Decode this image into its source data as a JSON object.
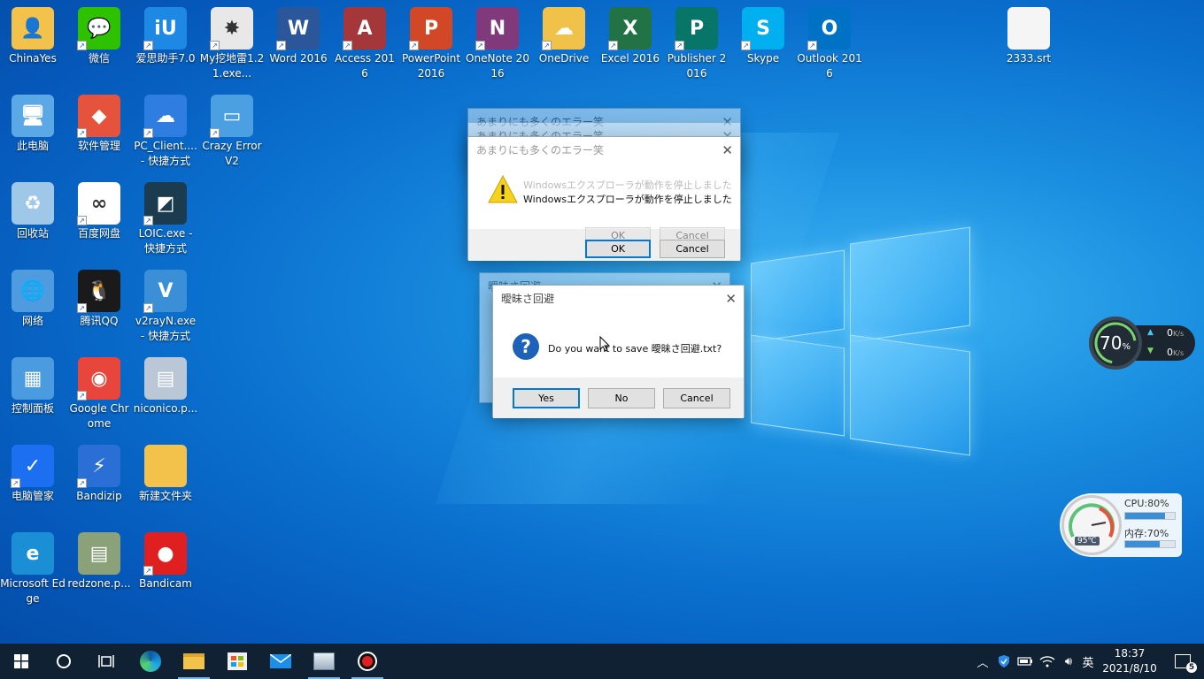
{
  "desktop_icons": [
    {
      "label": "ChinaYes",
      "glyph": "👤",
      "bg": "#f3c24a"
    },
    {
      "label": "微信",
      "glyph": "💬",
      "bg": "#2dc100"
    },
    {
      "label": "爱思助手7.0",
      "glyph": "iU",
      "bg": "#1e88e5"
    },
    {
      "label": "My挖地雷1.21.exe...",
      "glyph": "✸",
      "bg": "#e8e8e8"
    },
    {
      "label": "Word 2016",
      "glyph": "W",
      "bg": "#2b579a"
    },
    {
      "label": "Access 2016",
      "glyph": "A",
      "bg": "#a4373a"
    },
    {
      "label": "PowerPoint 2016",
      "glyph": "P",
      "bg": "#d24726"
    },
    {
      "label": "OneNote 2016",
      "glyph": "N",
      "bg": "#80397b"
    },
    {
      "label": "OneDrive",
      "glyph": "☁",
      "bg": "#f0c24a"
    },
    {
      "label": "Excel 2016",
      "glyph": "X",
      "bg": "#217346"
    },
    {
      "label": "Publisher 2016",
      "glyph": "P",
      "bg": "#077568"
    },
    {
      "label": "Skype",
      "glyph": "S",
      "bg": "#00aff0"
    },
    {
      "label": "Outlook 2016",
      "glyph": "O",
      "bg": "#0072c6"
    },
    {
      "label": "2333.srt",
      "glyph": "",
      "bg": "#f5f5f5"
    },
    {
      "label": "此电脑",
      "glyph": "🖥",
      "bg": "#5aa8e6"
    },
    {
      "label": "软件管理",
      "glyph": "◆",
      "bg": "#e6533c"
    },
    {
      "label": "PC_Client.... - 快捷方式",
      "glyph": "☁",
      "bg": "#2f7de0"
    },
    {
      "label": "Crazy Error V2",
      "glyph": "▭",
      "bg": "#4aa0e0"
    },
    {
      "label": "回收站",
      "glyph": "♻",
      "bg": "#9fc8e8"
    },
    {
      "label": "百度网盘",
      "glyph": "∞",
      "bg": "#ffffff"
    },
    {
      "label": "LOIC.exe - 快捷方式",
      "glyph": "◩",
      "bg": "#1b3c4f"
    },
    {
      "label": "网络",
      "glyph": "🌐",
      "bg": "#4f9be0"
    },
    {
      "label": "腾讯QQ",
      "glyph": "🐧",
      "bg": "#1a1a1a"
    },
    {
      "label": "v2rayN.exe - 快捷方式",
      "glyph": "V",
      "bg": "#3a8fd6"
    },
    {
      "label": "控制面板",
      "glyph": "▦",
      "bg": "#4b9be0"
    },
    {
      "label": "Google Chrome",
      "glyph": "◉",
      "bg": "#e8453c"
    },
    {
      "label": "niconico.p...",
      "glyph": "▤",
      "bg": "#b9c7d6"
    },
    {
      "label": "电脑管家",
      "glyph": "✓",
      "bg": "#1d6ff2"
    },
    {
      "label": "Bandizip",
      "glyph": "⚡",
      "bg": "#2a6fd6"
    },
    {
      "label": "新建文件夹",
      "glyph": "",
      "bg": "#f3c24a"
    },
    {
      "label": "Microsoft Edge",
      "glyph": "e",
      "bg": "#1a8fd6"
    },
    {
      "label": "redzone.p...",
      "glyph": "▤",
      "bg": "#8aa17a"
    },
    {
      "label": "Bandicam",
      "glyph": "●",
      "bg": "#e02020"
    }
  ],
  "error_dialog": {
    "ghost_title_1": "あまりにも多くのエラー笑",
    "ghost_title_2": "あまりにも多くのエラー笑",
    "title": "あまりにも多くのエラー笑",
    "ghost_message": "Windowsエクスプローラが動作を停止しました",
    "message": "Windowsエクスプローラが動作を停止しました",
    "ok_label": "OK",
    "cancel_label": "Cancel",
    "ghost_ok": "OK",
    "ghost_cancel": "Cancel"
  },
  "save_dialog": {
    "ghost_title": "曖昧さ回避",
    "title": "曖昧さ回避",
    "message": "Do you want to save 曖昧さ回避.txt?",
    "yes_label": "Yes",
    "no_label": "No",
    "cancel_label": "Cancel"
  },
  "net_widget": {
    "percent": "70",
    "unit": "%",
    "up": "0",
    "up_unit": "K/s",
    "down": "0",
    "down_unit": "K/s"
  },
  "sys_widget": {
    "temp": "95℃",
    "cpu_label": "CPU:80%",
    "cpu_level": 0.8,
    "mem_label": "内存:70%",
    "mem_level": 0.7
  },
  "taskbar": {
    "ime": "英",
    "time": "18:37",
    "date": "2021/8/10",
    "notification_count": "5"
  },
  "colors": {
    "accent": "#0078d7",
    "taskbar": "#0f2133"
  }
}
